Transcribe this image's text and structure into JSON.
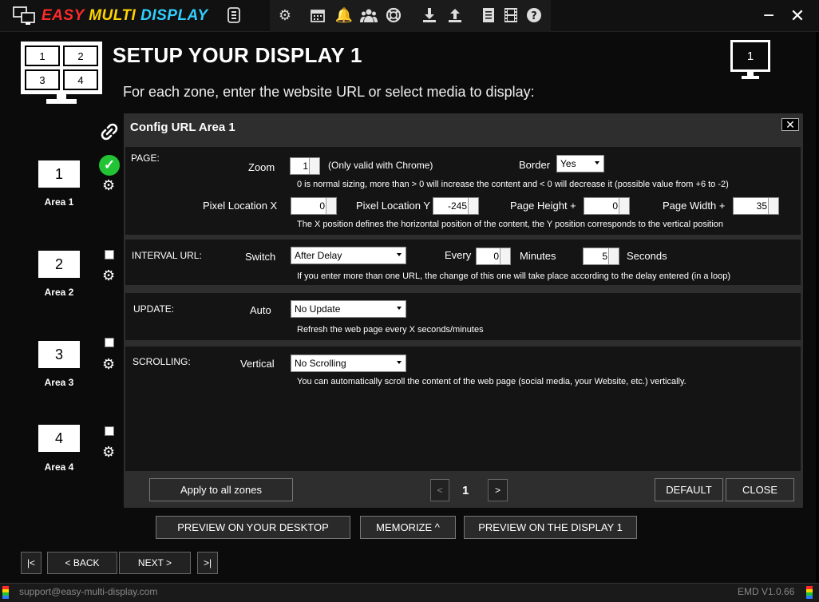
{
  "app": {
    "brand_part1": "EASY",
    "brand_part2": "MULTI",
    "brand_part3": "DISPLAY",
    "minimize": "−",
    "close": "✕"
  },
  "header": {
    "title": "SETUP YOUR DISPLAY 1",
    "subtitle": "For each zone, enter the website URL or select media to display:",
    "monitor_cells": [
      "1",
      "2",
      "3",
      "4"
    ],
    "display_number": "1"
  },
  "areas": [
    {
      "number": "1",
      "label": "Area 1",
      "configured": true
    },
    {
      "number": "2",
      "label": "Area 2",
      "configured": false
    },
    {
      "number": "3",
      "label": "Area 3",
      "configured": false
    },
    {
      "number": "4",
      "label": "Area 4",
      "configured": false
    }
  ],
  "config": {
    "title": "Config URL Area 1",
    "page": {
      "section": "PAGE:",
      "zoom_label": "Zoom",
      "zoom_value": "1",
      "zoom_note": "(Only valid with Chrome)",
      "border_label": "Border",
      "border_value": "Yes",
      "zoom_help": "0 is normal sizing, more than > 0 will increase the content and < 0 will decrease it (possible value from +6 to -2)",
      "px_label": "Pixel Location X",
      "px_value": "0",
      "py_label": "Pixel Location Y",
      "py_value": "-245",
      "ph_label": "Page Height +",
      "ph_value": "0",
      "pw_label": "Page Width +",
      "pw_value": "35",
      "xy_help": "The X position defines the horizontal position of the content, the Y position corresponds to the vertical position"
    },
    "interval": {
      "section": "INTERVAL URL:",
      "switch_label": "Switch",
      "switch_value": "After Delay",
      "every_label": "Every",
      "minutes_value": "0",
      "minutes_label": "Minutes",
      "seconds_value": "5",
      "seconds_label": "Seconds",
      "help": "If you enter more than one URL, the change of this one will take place according to the delay entered (in a loop)"
    },
    "update": {
      "section": "UPDATE:",
      "auto_label": "Auto",
      "auto_value": "No Update",
      "help": "Refresh the web page every X seconds/minutes"
    },
    "scrolling": {
      "section": "SCROLLING:",
      "vertical_label": "Vertical",
      "vertical_value": "No Scrolling",
      "help": "You can automatically scroll the content of the web page (social media, your Website, etc.) vertically."
    },
    "apply_all": "Apply to all zones",
    "page_prev": "<",
    "page_number": "1",
    "page_next": ">",
    "default_btn": "DEFAULT",
    "close_btn": "CLOSE"
  },
  "actions": {
    "preview_desktop": "PREVIEW ON YOUR DESKTOP",
    "memorize": "MEMORIZE ^",
    "preview_display": "PREVIEW ON THE DISPLAY 1"
  },
  "nav": {
    "first": "|<",
    "back": "< BACK",
    "next": "NEXT >",
    "last": ">|"
  },
  "status": {
    "support": "support@easy-multi-display.com",
    "version": "EMD V1.0.66"
  },
  "colors": {
    "brand_red": "#ff2a2a",
    "brand_yellow": "#ffd400",
    "brand_cyan": "#2fd0ff",
    "ok_green": "#22c435"
  }
}
